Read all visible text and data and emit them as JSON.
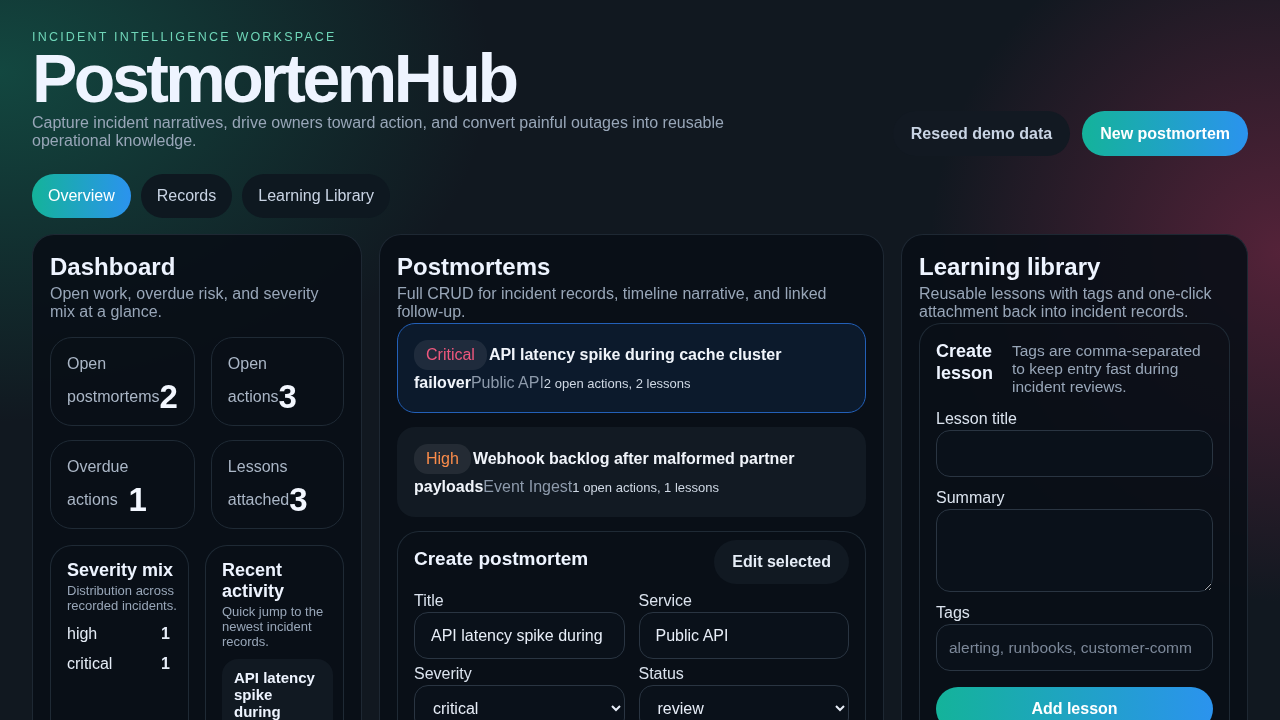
{
  "header": {
    "eyebrow": "INCIDENT INTELLIGENCE WORKSPACE",
    "title": "PostmortemHub",
    "subtitle": "Capture incident narratives, drive owners toward action, and convert painful outages into reusable operational knowledge.",
    "buttons": [
      {
        "label": "Reseed demo data",
        "kind": "secondary"
      },
      {
        "label": "New postmortem",
        "kind": "primary"
      }
    ]
  },
  "tabs": [
    {
      "label": "Overview",
      "selected": true
    },
    {
      "label": "Records",
      "selected": false
    },
    {
      "label": "Learning Library",
      "selected": false
    }
  ],
  "dashboard": {
    "title": "Dashboard",
    "subtitle": "Open work, overdue risk, and severity mix at a glance.",
    "stats": [
      {
        "label": "Open postmortems",
        "value": "2"
      },
      {
        "label": "Open actions",
        "value": "3"
      },
      {
        "label": "Overdue actions",
        "value": "1"
      },
      {
        "label": "Lessons attached",
        "value": "3"
      }
    ],
    "severity_mix": {
      "title": "Severity mix",
      "subtitle": "Distribution across recorded incidents.",
      "rows": [
        {
          "label": "high",
          "count": "1"
        },
        {
          "label": "critical",
          "count": "1"
        }
      ]
    },
    "recent_activity": {
      "title": "Recent activity",
      "subtitle": "Quick jump to the newest incident records.",
      "items": [
        {
          "title": "API latency spike during"
        }
      ]
    }
  },
  "postmortems": {
    "title": "Postmortems",
    "subtitle": "Full CRUD for incident records, timeline narrative, and linked follow-up.",
    "records": [
      {
        "severity": "Critical",
        "color": "#f0587e",
        "title": "API latency spike during cache cluster failover",
        "service": "Public API",
        "meta": "2 open actions, 2 lessons",
        "selected": true
      },
      {
        "severity": "High",
        "color": "#fb8c4a",
        "title": "Webhook backlog after malformed partner payloads",
        "service": "Event Ingest",
        "meta": "1 open actions, 1 lessons",
        "selected": false
      }
    ],
    "form": {
      "title": "Create postmortem",
      "button": "Edit selected",
      "fields": [
        {
          "label": "Title",
          "kind": "input",
          "value": "API latency spike during"
        },
        {
          "label": "Service",
          "kind": "input",
          "value": "Public API"
        },
        {
          "label": "Severity",
          "kind": "select",
          "value": "critical"
        },
        {
          "label": "Status",
          "kind": "select",
          "value": "review"
        }
      ]
    }
  },
  "library": {
    "title": "Learning library",
    "subtitle": "Reusable lessons with tags and one-click attachment back into incident records.",
    "form": {
      "title": "Create lesson",
      "note": "Tags are comma-separated to keep entry fast during incident reviews.",
      "fields": [
        {
          "label": "Lesson title",
          "kind": "input"
        },
        {
          "label": "Summary",
          "kind": "textarea"
        },
        {
          "label": "Tags",
          "kind": "input",
          "placeholder": "alerting, runbooks, customer-comm"
        }
      ],
      "button": "Add lesson"
    }
  }
}
